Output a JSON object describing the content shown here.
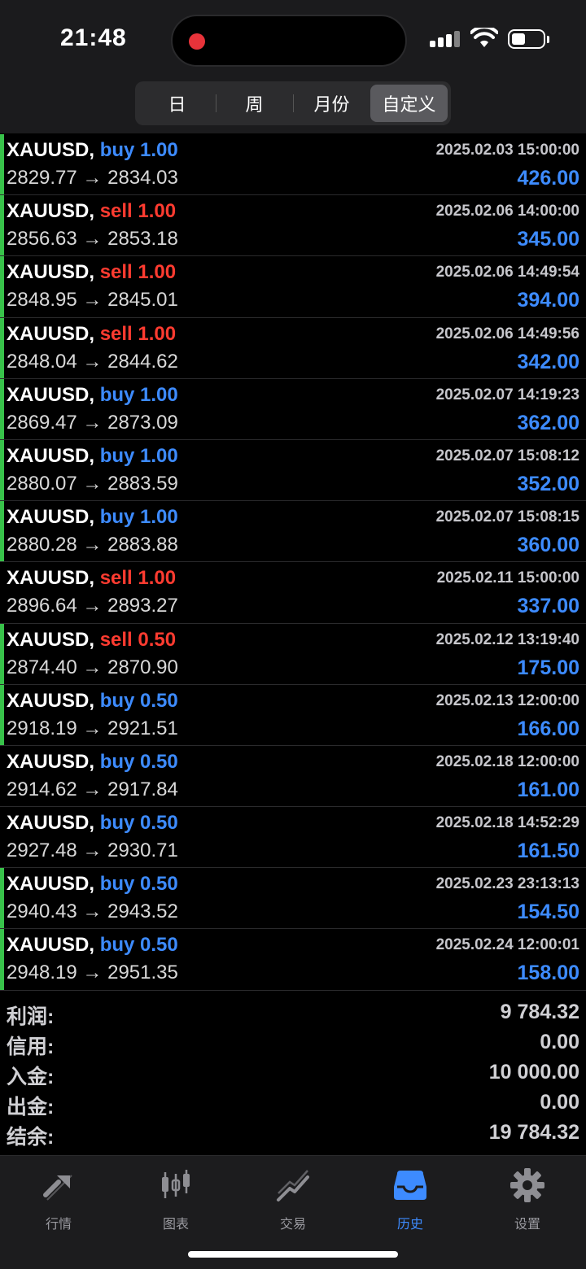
{
  "status": {
    "time": "21:48"
  },
  "segments": [
    {
      "label": "日",
      "active": false
    },
    {
      "label": "周",
      "active": false
    },
    {
      "label": "月份",
      "active": false
    },
    {
      "label": "自定义",
      "active": true
    }
  ],
  "deals": [
    {
      "symbol": "XAUUSD,",
      "type": "buy",
      "volume": "1.00",
      "prices": "2829.77 → 2834.03",
      "datetime": "2025.02.03 15:00:00",
      "profit": "426.00"
    },
    {
      "symbol": "XAUUSD,",
      "type": "sell",
      "volume": "1.00",
      "prices": "2856.63 → 2853.18",
      "datetime": "2025.02.06 14:00:00",
      "profit": "345.00"
    },
    {
      "symbol": "XAUUSD,",
      "type": "sell",
      "volume": "1.00",
      "prices": "2848.95 → 2845.01",
      "datetime": "2025.02.06 14:49:54",
      "profit": "394.00"
    },
    {
      "symbol": "XAUUSD,",
      "type": "sell",
      "volume": "1.00",
      "prices": "2848.04 → 2844.62",
      "datetime": "2025.02.06 14:49:56",
      "profit": "342.00"
    },
    {
      "symbol": "XAUUSD,",
      "type": "buy",
      "volume": "1.00",
      "prices": "2869.47 → 2873.09",
      "datetime": "2025.02.07 14:19:23",
      "profit": "362.00"
    },
    {
      "symbol": "XAUUSD,",
      "type": "buy",
      "volume": "1.00",
      "prices": "2880.07 → 2883.59",
      "datetime": "2025.02.07 15:08:12",
      "profit": "352.00"
    },
    {
      "symbol": "XAUUSD,",
      "type": "buy",
      "volume": "1.00",
      "prices": "2880.28 → 2883.88",
      "datetime": "2025.02.07 15:08:15",
      "profit": "360.00"
    },
    {
      "symbol": "XAUUSD,",
      "type": "sell",
      "volume": "1.00",
      "prices": "2896.64 → 2893.27",
      "datetime": "2025.02.11 15:00:00",
      "profit": "337.00"
    },
    {
      "symbol": "XAUUSD,",
      "type": "sell",
      "volume": "0.50",
      "prices": "2874.40 → 2870.90",
      "datetime": "2025.02.12 13:19:40",
      "profit": "175.00"
    },
    {
      "symbol": "XAUUSD,",
      "type": "buy",
      "volume": "0.50",
      "prices": "2918.19 → 2921.51",
      "datetime": "2025.02.13 12:00:00",
      "profit": "166.00"
    },
    {
      "symbol": "XAUUSD,",
      "type": "buy",
      "volume": "0.50",
      "prices": "2914.62 → 2917.84",
      "datetime": "2025.02.18 12:00:00",
      "profit": "161.00"
    },
    {
      "symbol": "XAUUSD,",
      "type": "buy",
      "volume": "0.50",
      "prices": "2927.48 → 2930.71",
      "datetime": "2025.02.18 14:52:29",
      "profit": "161.50"
    },
    {
      "symbol": "XAUUSD,",
      "type": "buy",
      "volume": "0.50",
      "prices": "2940.43 → 2943.52",
      "datetime": "2025.02.23 23:13:13",
      "profit": "154.50"
    },
    {
      "symbol": "XAUUSD,",
      "type": "buy",
      "volume": "0.50",
      "prices": "2948.19 → 2951.35",
      "datetime": "2025.02.24 12:00:01",
      "profit": "158.00"
    }
  ],
  "summary": [
    {
      "label": "利润:",
      "value": "9 784.32"
    },
    {
      "label": "信用:",
      "value": "0.00"
    },
    {
      "label": "入金:",
      "value": "10 000.00"
    },
    {
      "label": "出金:",
      "value": "0.00"
    },
    {
      "label": "结余:",
      "value": "19 784.32"
    }
  ],
  "tabs": [
    {
      "label": "行情",
      "icon": "quotes-icon",
      "active": false
    },
    {
      "label": "图表",
      "icon": "chart-icon",
      "active": false
    },
    {
      "label": "交易",
      "icon": "trade-icon",
      "active": false
    },
    {
      "label": "历史",
      "icon": "history-icon",
      "active": true
    },
    {
      "label": "设置",
      "icon": "settings-icon",
      "active": false
    }
  ],
  "colors": {
    "buy": "#3d8bff",
    "sell": "#ff3b30",
    "accent": "#3d8bff",
    "bar": "#38c24a"
  }
}
